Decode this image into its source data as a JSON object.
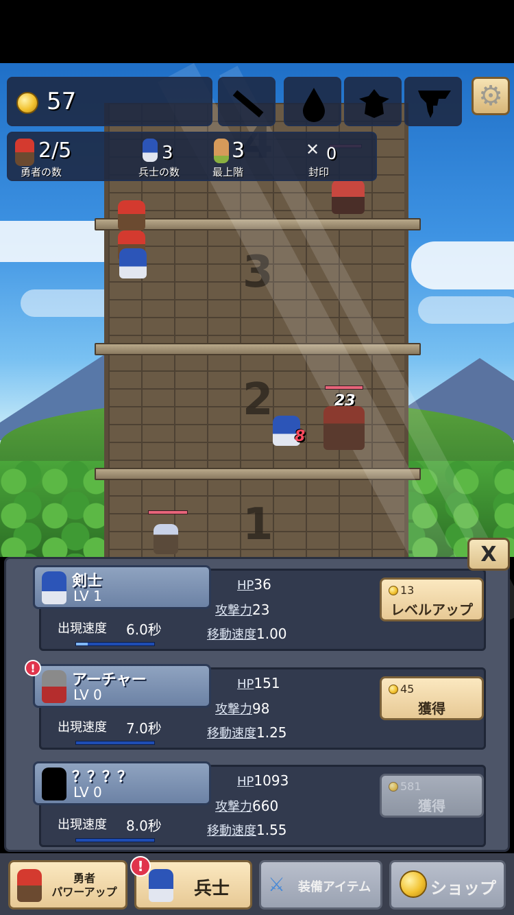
{
  "hud": {
    "coins": "57",
    "heroes": {
      "value": "2/5",
      "label": "勇者の数"
    },
    "soldiers": {
      "value": "3",
      "label": "兵士の数"
    },
    "top_floor": {
      "value": "3",
      "label": "最上階"
    },
    "seal": {
      "value": "0",
      "label": "封印"
    }
  },
  "tower": {
    "floors": [
      "4",
      "3",
      "2",
      "1"
    ],
    "damage_popups": [
      {
        "text": "23",
        "color": "#ffffff"
      },
      {
        "text": "8",
        "color": "#ff4a5e"
      }
    ]
  },
  "panel": {
    "close_label": "X",
    "units": [
      {
        "name": "剣士",
        "level": "LV 1",
        "hp_label": "HP",
        "hp": "36",
        "atk_label": "攻撃力",
        "atk": "23",
        "speed_label": "移動速度",
        "speed": "1.00",
        "spawn_label": "出現速度",
        "spawn": "6.0秒",
        "spawn_progress": 0.15,
        "cost": "13",
        "action": "レベルアップ",
        "enabled": true,
        "alert": false
      },
      {
        "name": "アーチャー",
        "level": "LV 0",
        "hp_label": "HP",
        "hp": "151",
        "atk_label": "攻撃力",
        "atk": "98",
        "speed_label": "移動速度",
        "speed": "1.25",
        "spawn_label": "出現速度",
        "spawn": "7.0秒",
        "spawn_progress": 0,
        "cost": "45",
        "action": "獲得",
        "enabled": true,
        "alert": true
      },
      {
        "name": "？？？？",
        "level": "LV 0",
        "hp_label": "HP",
        "hp": "1093",
        "atk_label": "攻撃力",
        "atk": "660",
        "speed_label": "移動速度",
        "speed": "1.55",
        "spawn_label": "出現速度",
        "spawn": "8.0秒",
        "spawn_progress": 0,
        "cost": "581",
        "action": "獲得",
        "enabled": false,
        "alert": false
      }
    ]
  },
  "nav": {
    "hero_power": "勇者\nパワーアップ",
    "soldier": "兵士",
    "equipment": "装備アイテム",
    "shop": "ショップ",
    "soldier_alert": "!"
  },
  "alert_mark": "!",
  "icons": [
    "sword-icon",
    "drop-icon",
    "goblin-icon",
    "tornado-icon",
    "gear-icon"
  ]
}
